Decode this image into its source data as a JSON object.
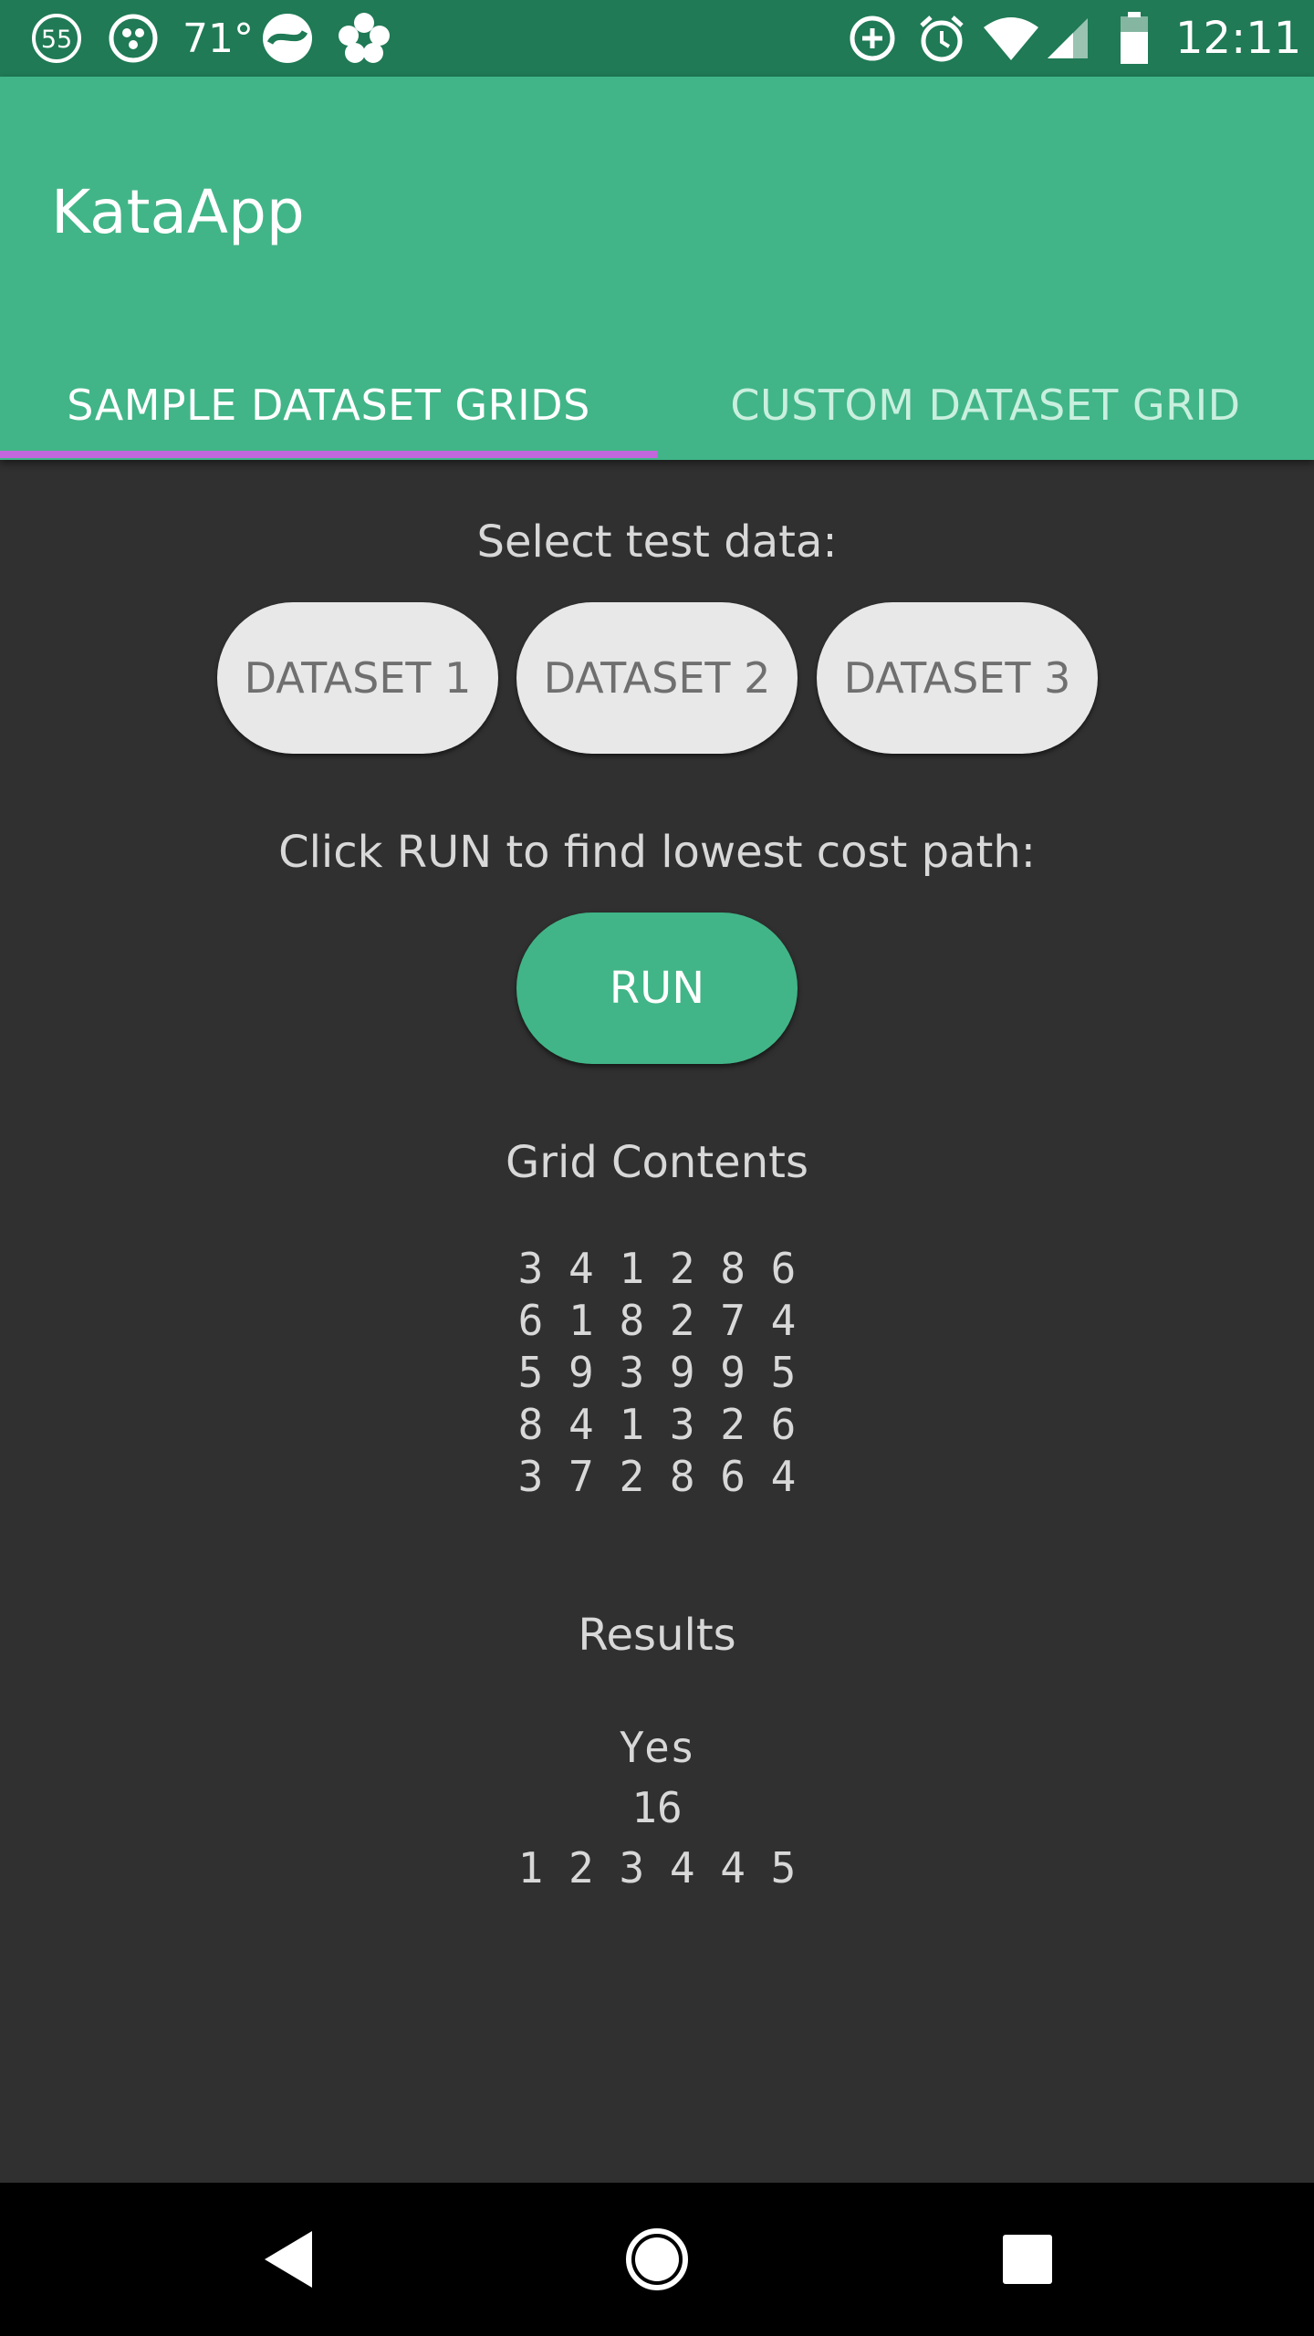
{
  "status_bar": {
    "notification_count": "55",
    "temperature": "71°",
    "time": "12:11",
    "icons": [
      "notification-count-icon",
      "dots-app-icon",
      "swirl-app-icon",
      "flower-app-icon",
      "data-saver-icon",
      "alarm-icon",
      "wifi-icon",
      "cell-signal-icon",
      "battery-icon"
    ],
    "background": "#1f7a55"
  },
  "app_bar": {
    "title": "KataApp",
    "background": "#41b587"
  },
  "tabs": [
    {
      "label": "SAMPLE DATASET GRIDS",
      "active": true
    },
    {
      "label": "CUSTOM DATASET GRID",
      "active": false
    }
  ],
  "tab_indicator_color": "#c267dc",
  "select_section": {
    "prompt": "Select test data:",
    "buttons": [
      "DATASET 1",
      "DATASET 2",
      "DATASET 3"
    ]
  },
  "run_section": {
    "prompt": "Click RUN to find lowest cost path:",
    "button_label": "RUN"
  },
  "grid_section": {
    "heading": "Grid Contents",
    "rows": [
      "3 4 1 2 8 6",
      "6 1 8 2 7 4",
      "5 9 3 9 9 5",
      "8 4 1 3 2 6",
      "3 7 2 8 6 4"
    ]
  },
  "results_section": {
    "heading": "Results",
    "success": "Yes",
    "total_cost": "16",
    "path": "1 2 3 4 4 5"
  },
  "nav_bar": {
    "buttons": [
      "back-icon",
      "home-icon",
      "recents-icon"
    ]
  }
}
